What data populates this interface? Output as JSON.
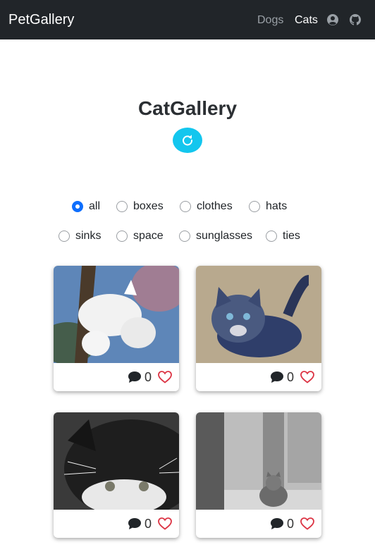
{
  "navbar": {
    "brand": "PetGallery",
    "links": [
      {
        "label": "Dogs",
        "active": false
      },
      {
        "label": "Cats",
        "active": true
      }
    ],
    "icons": [
      "user-circle-icon",
      "github-icon"
    ]
  },
  "header": {
    "title": "CatGallery",
    "refresh_icon": "refresh-icon"
  },
  "filters": {
    "selected": "all",
    "options": [
      "all",
      "boxes",
      "clothes",
      "hats",
      "sinks",
      "space",
      "sunglasses",
      "ties"
    ]
  },
  "cards": [
    {
      "comments": "0",
      "photo": "white cat climbing tree"
    },
    {
      "comments": "0",
      "photo": "fluffy blue-grey kitten"
    },
    {
      "comments": "0",
      "photo": "black and white cat close-up"
    },
    {
      "comments": "0",
      "photo": "cat sitting on street"
    }
  ],
  "colors": {
    "navbar": "#212529",
    "accent": "#13c6ee",
    "radio_checked": "#0d6efd",
    "heart": "#dc3545"
  }
}
